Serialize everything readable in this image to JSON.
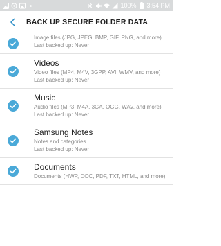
{
  "status_bar": {
    "battery_percent": "100%",
    "time": "3:54 PM"
  },
  "app_bar": {
    "title": "BACK UP SECURE FOLDER DATA"
  },
  "items": [
    {
      "title": "",
      "description": "Image files (JPG, JPEG, BMP, GIF, PNG, and more)",
      "last_backed_up": "Last backed up: Never",
      "checked": true
    },
    {
      "title": "Videos",
      "description": "Video files (MP4, M4V, 3GPP, AVI, WMV, and more)",
      "last_backed_up": "Last backed up: Never",
      "checked": true
    },
    {
      "title": "Music",
      "description": "Audio files (MP3, M4A, 3GA, OGG, WAV, and more)",
      "last_backed_up": "Last backed up: Never",
      "checked": true
    },
    {
      "title": "Samsung Notes",
      "description": "Notes and categories",
      "last_backed_up": "Last backed up: Never",
      "checked": true
    },
    {
      "title": "Documents",
      "description": "Documents (HWP, DOC, PDF, TXT, HTML, and more)",
      "last_backed_up": "",
      "checked": true
    }
  ],
  "colors": {
    "accent": "#4aa9d8",
    "status_bar_bg": "#d8dadb"
  }
}
